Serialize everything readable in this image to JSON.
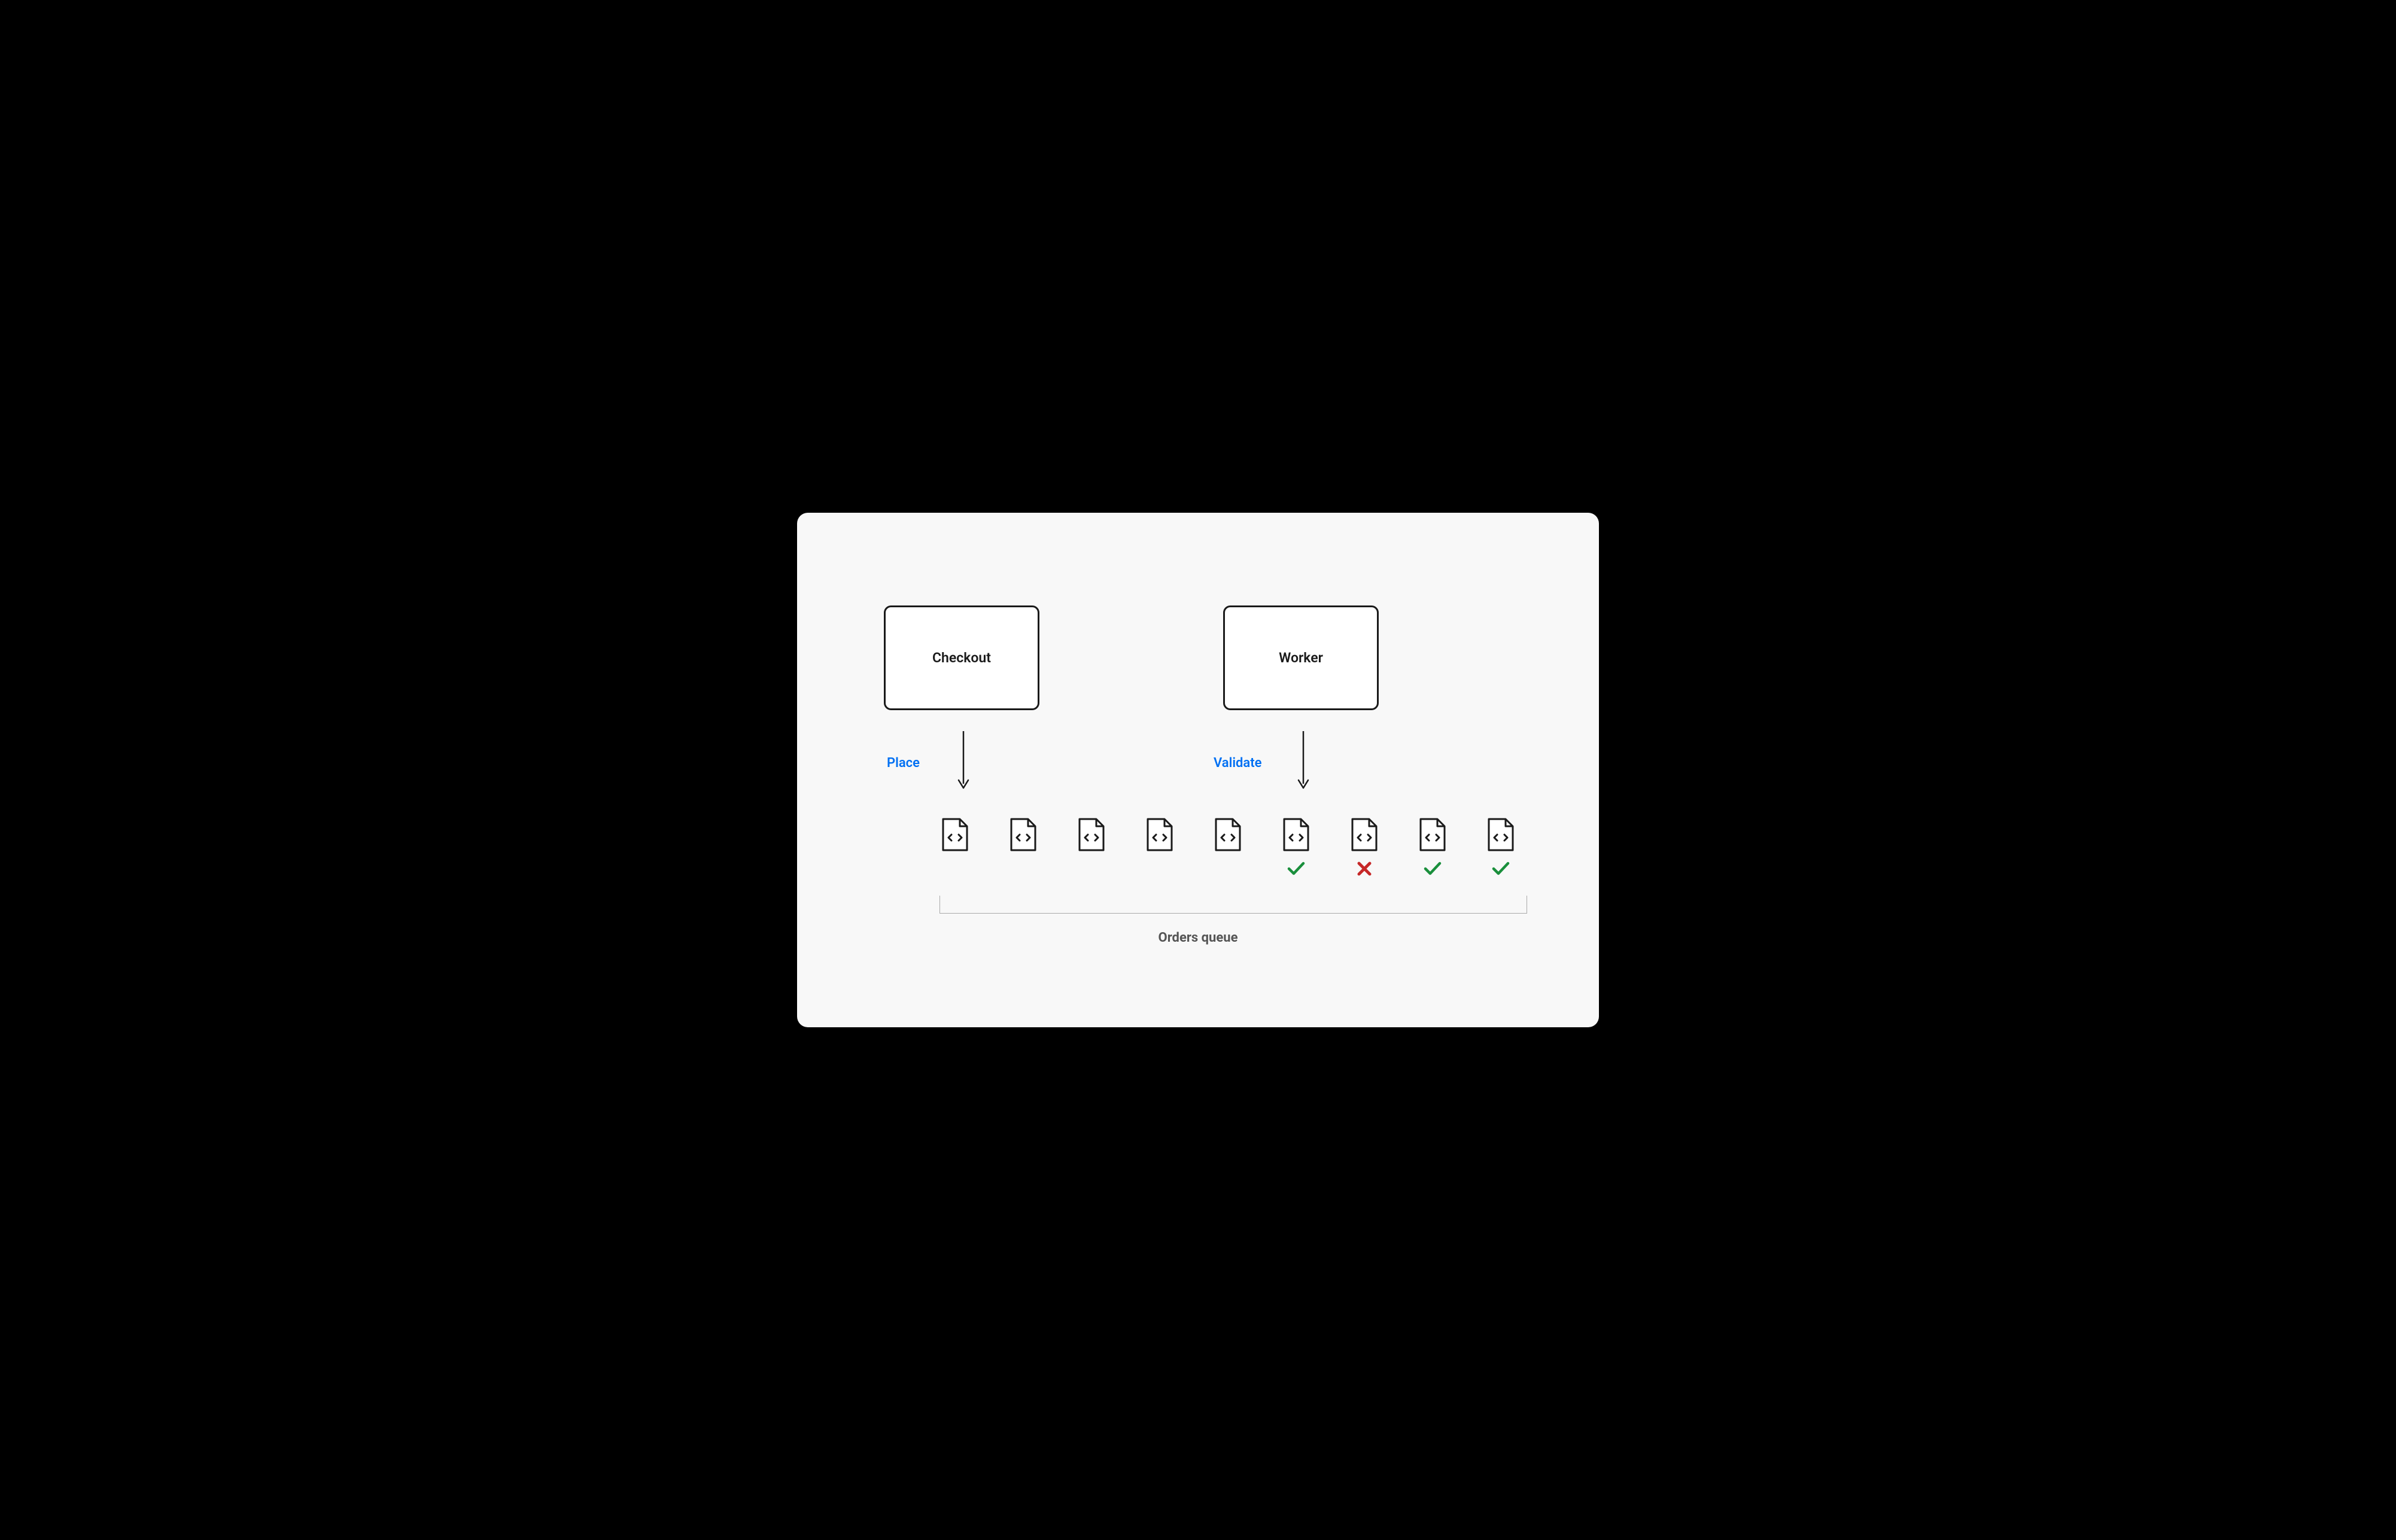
{
  "diagram": {
    "nodes": {
      "checkout": {
        "label": "Checkout",
        "action_label": "Place"
      },
      "worker": {
        "label": "Worker",
        "action_label": "Validate"
      }
    },
    "queue": {
      "label": "Orders queue",
      "items": [
        {
          "status": "none"
        },
        {
          "status": "none"
        },
        {
          "status": "none"
        },
        {
          "status": "none"
        },
        {
          "status": "none"
        },
        {
          "status": "pass"
        },
        {
          "status": "fail"
        },
        {
          "status": "pass"
        },
        {
          "status": "pass"
        }
      ]
    },
    "colors": {
      "accent_blue": "#0070f3",
      "pass_green": "#1a8f3c",
      "fail_red": "#c62828",
      "box_border": "#1a1a1a",
      "queue_label": "#555555",
      "bracket": "#aaaaaa"
    }
  }
}
